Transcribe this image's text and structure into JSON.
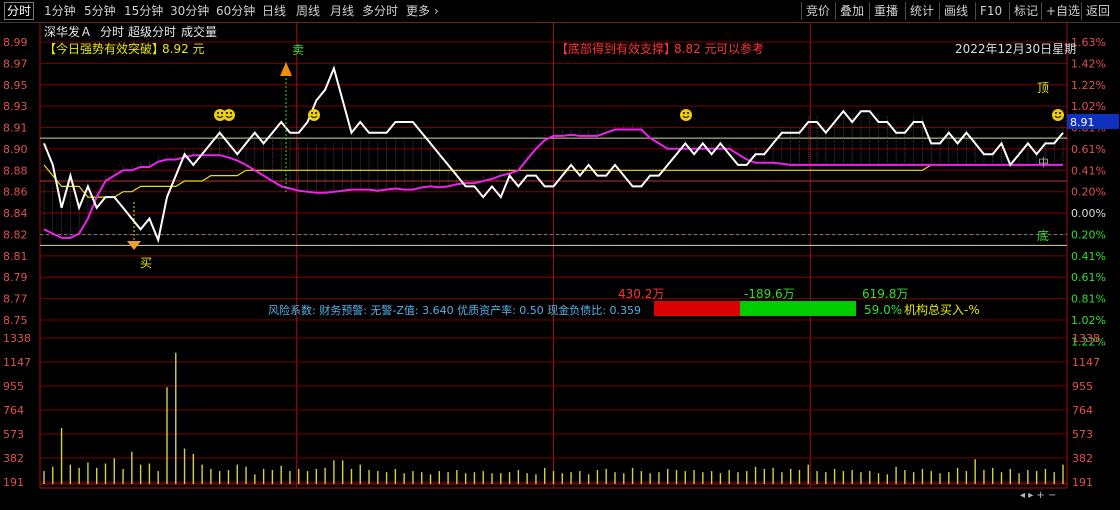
{
  "topbar": {
    "left_tabs": [
      "分时",
      "1分钟",
      "5分钟",
      "15分钟",
      "30分钟",
      "60分钟",
      "日线",
      "周线",
      "月线",
      "多分时",
      "更多"
    ],
    "more_arrow": "›",
    "right_tabs": [
      "竞价",
      "叠加",
      "重播",
      "统计",
      "画线",
      "F10",
      "标记",
      "+自选",
      "返回"
    ]
  },
  "header": {
    "stock_name": "深华发Ａ",
    "items": [
      "分时",
      "超级分时",
      "成交量"
    ]
  },
  "signals": {
    "breakout_label": "【今日强势有效突破】",
    "breakout_price": "8.92 元",
    "support_label": "【底部得到有效支撑】",
    "support_price": "8.82 元",
    "support_suffix": "可以参考",
    "date": "2022年12月30日星期",
    "buy": "买",
    "sell": "卖",
    "top": "顶",
    "bottom": "底",
    "mid": "中",
    "current_price_tag": "8.91"
  },
  "axes": {
    "price_left": [
      "8.99",
      "8.97",
      "8.95",
      "8.93",
      "8.91",
      "8.90",
      "8.88",
      "8.86",
      "8.84",
      "8.82",
      "8.81",
      "8.79",
      "8.77",
      "8.75"
    ],
    "pct_right": [
      "1.63%",
      "1.42%",
      "1.22%",
      "1.02%",
      "0.81%",
      "0.61%",
      "0.41%",
      "0.20%",
      "0.00%",
      "0.20%",
      "0.41%",
      "0.61%",
      "0.81%",
      "1.02%",
      "1.22%"
    ],
    "volume_ticks": [
      "1338",
      "1147",
      "955",
      "764",
      "573",
      "382",
      "191"
    ],
    "vol_scale_max": 1338
  },
  "finance": {
    "text": "风险系数: 财务预警: 无警-Z值: 3.640 优质资产率: 0.50 现金负债比: 0.359",
    "inflow_red": "430.2万",
    "inflow_mid": "-189.6万",
    "inflow_green": "619.8万",
    "ratio": "59.0%",
    "institution": "机构总买入-%"
  },
  "colors": {
    "up_red": "#ff3333",
    "down_green": "#33dd33",
    "price_line": "#ffffff",
    "avg_line": "#e8e000",
    "magenta": "#ee22ee",
    "grid": "#7a0000",
    "tick_text": "#e05050"
  },
  "chart_data": {
    "type": "line",
    "ylim": [
      8.7455,
      9.0045
    ],
    "pre_close": 8.875,
    "series": [
      {
        "values": [
          8.91,
          8.89,
          8.85,
          8.88,
          8.85,
          8.87,
          8.85,
          8.86,
          8.86,
          8.85,
          8.84,
          8.83,
          8.84,
          8.82,
          8.86,
          8.88,
          8.9,
          8.89,
          8.9,
          8.91,
          8.92,
          8.91,
          8.9,
          8.91,
          8.92,
          8.91,
          8.92,
          8.93,
          8.92,
          8.92,
          8.93,
          8.95,
          8.96,
          8.98,
          8.95,
          8.92,
          8.93,
          8.92,
          8.92,
          8.92,
          8.93,
          8.93,
          8.93,
          8.92,
          8.91,
          8.9,
          8.89,
          8.88,
          8.87,
          8.87,
          8.86,
          8.87,
          8.86,
          8.88,
          8.87,
          8.88,
          8.88,
          8.87,
          8.87,
          8.88,
          8.89,
          8.88,
          8.89,
          8.88,
          8.88,
          8.89,
          8.88,
          8.87,
          8.87,
          8.88,
          8.88,
          8.89,
          8.9,
          8.91,
          8.9,
          8.91,
          8.9,
          8.91,
          8.9,
          8.89,
          8.89,
          8.9,
          8.9,
          8.91,
          8.92,
          8.92,
          8.92,
          8.93,
          8.93,
          8.92,
          8.93,
          8.94,
          8.93,
          8.94,
          8.94,
          8.93,
          8.93,
          8.92,
          8.92,
          8.93,
          8.93,
          8.91,
          8.91,
          8.92,
          8.91,
          8.92,
          8.91,
          8.9,
          8.9,
          8.91,
          8.89,
          8.9,
          8.91,
          8.9,
          8.91,
          8.91,
          8.92
        ]
      },
      {
        "values": [
          8.89,
          8.88,
          8.87,
          8.87,
          8.87,
          8.86,
          8.86,
          8.86,
          8.86,
          8.865,
          8.865,
          8.87,
          8.87,
          8.87,
          8.87,
          8.87,
          8.875,
          8.875,
          8.875,
          8.88,
          8.88,
          8.88,
          8.88,
          8.885,
          8.885,
          8.885,
          8.885,
          8.885,
          8.885,
          8.885,
          8.885,
          8.885,
          8.885,
          8.885,
          8.885,
          8.885,
          8.885,
          8.885,
          8.885,
          8.885,
          8.885,
          8.885,
          8.885,
          8.885,
          8.885,
          8.885,
          8.885,
          8.885,
          8.885,
          8.885,
          8.885,
          8.885,
          8.885,
          8.885,
          8.885,
          8.885,
          8.885,
          8.885,
          8.885,
          8.885,
          8.885,
          8.885,
          8.885,
          8.885,
          8.885,
          8.885,
          8.885,
          8.885,
          8.885,
          8.885,
          8.885,
          8.885,
          8.885,
          8.885,
          8.885,
          8.885,
          8.885,
          8.885,
          8.885,
          8.885,
          8.885,
          8.885,
          8.885,
          8.885,
          8.885,
          8.885,
          8.885,
          8.885,
          8.885,
          8.885,
          8.885,
          8.885,
          8.885,
          8.885,
          8.885,
          8.885,
          8.885,
          8.885,
          8.885,
          8.885,
          8.885,
          8.89,
          8.89,
          8.89,
          8.89,
          8.89,
          8.89,
          8.89,
          8.89,
          8.89,
          8.89,
          8.89,
          8.89,
          8.89,
          8.89,
          8.89,
          8.89
        ]
      },
      {
        "values": [
          8.83,
          8.826,
          8.822,
          8.822,
          8.826,
          8.84,
          8.86,
          8.875,
          8.88,
          8.885,
          8.885,
          8.888,
          8.888,
          8.893,
          8.895,
          8.895,
          8.897,
          8.899,
          8.899,
          8.899,
          8.899,
          8.897,
          8.894,
          8.89,
          8.885,
          8.88,
          8.875,
          8.87,
          8.868,
          8.866,
          8.865,
          8.864,
          8.864,
          8.865,
          8.866,
          8.867,
          8.867,
          8.867,
          8.866,
          8.867,
          8.868,
          8.867,
          8.867,
          8.869,
          8.87,
          8.869,
          8.87,
          8.872,
          8.873,
          8.873,
          8.875,
          8.877,
          8.88,
          8.882,
          8.885,
          8.895,
          8.905,
          8.913,
          8.917,
          8.917,
          8.918,
          8.917,
          8.917,
          8.917,
          8.92,
          8.923,
          8.923,
          8.923,
          8.923,
          8.915,
          8.91,
          8.905,
          8.905,
          8.905,
          8.905,
          8.905,
          8.905,
          8.905,
          8.905,
          8.9,
          8.895,
          8.892,
          8.892,
          8.892,
          8.891,
          8.89,
          8.89,
          8.89,
          8.89,
          8.89,
          8.89,
          8.89,
          8.89,
          8.89,
          8.89,
          8.89,
          8.89,
          8.89,
          8.89,
          8.89,
          8.89,
          8.89,
          8.89,
          8.89,
          8.89,
          8.89,
          8.89,
          8.89,
          8.89,
          8.89,
          8.89,
          8.89,
          8.89,
          8.89,
          8.89,
          8.89,
          8.89
        ]
      },
      {
        "values": [
          120,
          160,
          520,
          180,
          150,
          200,
          150,
          190,
          240,
          140,
          300,
          180,
          190,
          120,
          900,
          1220,
          330,
          280,
          180,
          140,
          120,
          130,
          180,
          160,
          90,
          140,
          130,
          170,
          120,
          140,
          120,
          140,
          150,
          220,
          220,
          140,
          180,
          130,
          120,
          110,
          140,
          100,
          120,
          110,
          90,
          120,
          110,
          130,
          100,
          110,
          120,
          100,
          100,
          110,
          130,
          100,
          90,
          150,
          120,
          100,
          110,
          120,
          90,
          130,
          140,
          110,
          100,
          150,
          120,
          100,
          110,
          140,
          130,
          120,
          130,
          110,
          120,
          100,
          130,
          110,
          120,
          160,
          140,
          150,
          110,
          140,
          130,
          180,
          120,
          110,
          140,
          120,
          130,
          110,
          120,
          100,
          90,
          160,
          130,
          110,
          140,
          120,
          100,
          110,
          150,
          120,
          230,
          130,
          150,
          110,
          140,
          100,
          130,
          120,
          140,
          110,
          180
        ]
      }
    ]
  }
}
